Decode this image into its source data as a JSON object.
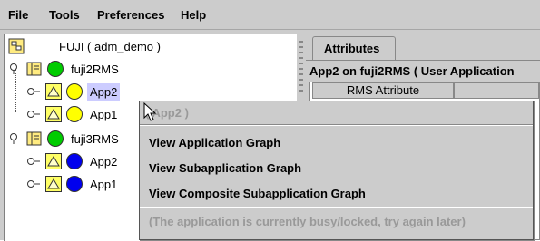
{
  "menubar": {
    "items": [
      "File",
      "Tools",
      "Preferences",
      "Help"
    ]
  },
  "tree": {
    "root_label": "FUJI ( adm_demo )",
    "nodes": [
      {
        "label": "fuji2RMS",
        "status_color": "#00cc00"
      },
      {
        "label": "App2",
        "status_color": "#ffff00",
        "selected": true
      },
      {
        "label": "App1",
        "status_color": "#ffff00"
      },
      {
        "label": "fuji3RMS",
        "status_color": "#00cc00"
      },
      {
        "label": "App2",
        "status_color": "#0000ee"
      },
      {
        "label": "App1",
        "status_color": "#0000ee"
      }
    ]
  },
  "right": {
    "tab_label": "Attributes",
    "title": "App2 on fuji2RMS ( User Application",
    "column_header": "RMS Attribute"
  },
  "popup": {
    "header": "( App2 )",
    "items": [
      "View Application Graph",
      "View Subapplication Graph",
      "View Composite Subapplication Graph"
    ],
    "disabled_note": "(The application is currently busy/locked, try again later)"
  }
}
